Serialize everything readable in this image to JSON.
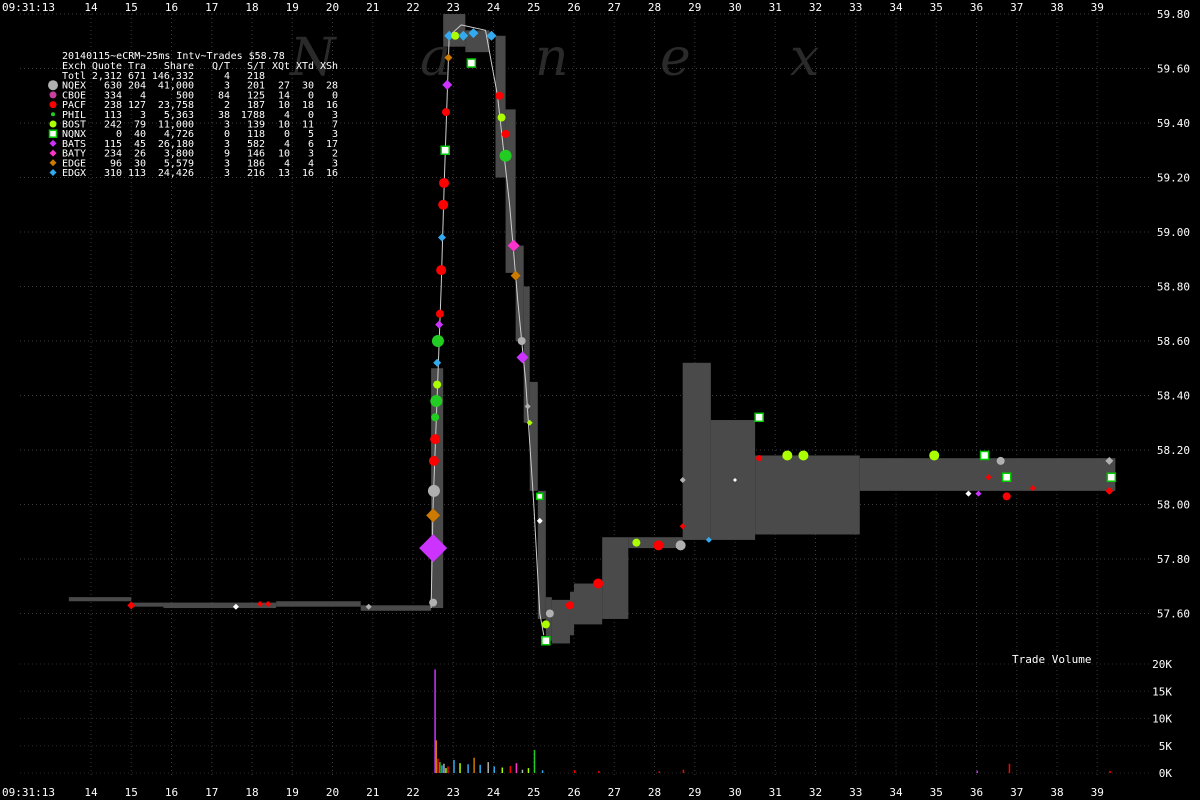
{
  "chart_data": {
    "type": "scatter",
    "title": "20140115~eCRM~25ms Intv~Trades $58.78",
    "start_time": "09:31:13",
    "watermark": [
      "N",
      "a",
      "n",
      "e",
      "x"
    ],
    "x_ticks": [
      "14",
      "15",
      "16",
      "17",
      "18",
      "19",
      "20",
      "21",
      "22",
      "23",
      "24",
      "25",
      "26",
      "27",
      "28",
      "29",
      "30",
      "31",
      "32",
      "33",
      "34",
      "35",
      "36",
      "37",
      "38",
      "39"
    ],
    "y_ticks": [
      "59.80",
      "59.60",
      "59.40",
      "59.20",
      "59.00",
      "58.80",
      "58.60",
      "58.40",
      "58.20",
      "58.00",
      "57.80",
      "57.60"
    ],
    "ylim": [
      57.42,
      59.86
    ],
    "volume_label": "Trade Volume",
    "volume_ticks": [
      "20K",
      "15K",
      "10K",
      "5K",
      "0K"
    ],
    "volume_max": 20000,
    "grid": true,
    "table": {
      "headers": [
        "Exch",
        "Quote",
        "Tra",
        "Share",
        "Q/T",
        "S/T",
        "XQt",
        "XTd",
        "XSh"
      ],
      "rows": [
        {
          "exch": "Totl",
          "quote": "2,312",
          "tra": "671",
          "share": "146,332",
          "qt": "4",
          "st": "218",
          "xqt": "",
          "xtd": "",
          "xsh": "",
          "color": "",
          "shape": ""
        },
        {
          "exch": "NQEX",
          "quote": "630",
          "tra": "204",
          "share": "41,000",
          "qt": "3",
          "st": "201",
          "xqt": "27",
          "xtd": "30",
          "xsh": "28",
          "color": "#b0b0b0",
          "shape": "circle-lg"
        },
        {
          "exch": "CBOE",
          "quote": "334",
          "tra": "4",
          "share": "500",
          "qt": "84",
          "st": "125",
          "xqt": "14",
          "xtd": "0",
          "xsh": "0",
          "color": "#c8409c",
          "shape": "circle"
        },
        {
          "exch": "PACF",
          "quote": "238",
          "tra": "127",
          "share": "23,758",
          "qt": "2",
          "st": "187",
          "xqt": "10",
          "xtd": "18",
          "xsh": "16",
          "color": "#ff0000",
          "shape": "circle"
        },
        {
          "exch": "PHIL",
          "quote": "113",
          "tra": "3",
          "share": "5,363",
          "qt": "38",
          "st": "1788",
          "xqt": "4",
          "xtd": "0",
          "xsh": "3",
          "color": "#22cc22",
          "shape": "circle-sm"
        },
        {
          "exch": "BOST",
          "quote": "242",
          "tra": "79",
          "share": "11,000",
          "qt": "3",
          "st": "139",
          "xqt": "10",
          "xtd": "11",
          "xsh": "7",
          "color": "#aaff00",
          "shape": "circle"
        },
        {
          "exch": "NQNX",
          "quote": "0",
          "tra": "40",
          "share": "4,726",
          "qt": "0",
          "st": "118",
          "xqt": "0",
          "xtd": "5",
          "xsh": "3",
          "color": "#00cc00",
          "shape": "square"
        },
        {
          "exch": "BATS",
          "quote": "115",
          "tra": "45",
          "share": "26,180",
          "qt": "3",
          "st": "582",
          "xqt": "4",
          "xtd": "6",
          "xsh": "17",
          "color": "#cc33ff",
          "shape": "diamond"
        },
        {
          "exch": "BATY",
          "quote": "234",
          "tra": "26",
          "share": "3,800",
          "qt": "9",
          "st": "146",
          "xqt": "10",
          "xtd": "3",
          "xsh": "2",
          "color": "#ff33cc",
          "shape": "diamond"
        },
        {
          "exch": "EDGE",
          "quote": "96",
          "tra": "30",
          "share": "5,579",
          "qt": "3",
          "st": "186",
          "xqt": "4",
          "xtd": "4",
          "xsh": "3",
          "color": "#cc7a00",
          "shape": "diamond"
        },
        {
          "exch": "EDGX",
          "quote": "310",
          "tra": "113",
          "share": "24,426",
          "qt": "3",
          "st": "216",
          "xqt": "13",
          "xtd": "16",
          "xsh": "16",
          "color": "#33aaee",
          "shape": "diamond"
        }
      ]
    },
    "quote_band": [
      {
        "x0": 13.45,
        "x1": 15.0,
        "lo": 57.645,
        "hi": 57.66
      },
      {
        "x0": 15.0,
        "x1": 15.8,
        "lo": 57.625,
        "hi": 57.64
      },
      {
        "x0": 15.8,
        "x1": 18.6,
        "lo": 57.62,
        "hi": 57.64
      },
      {
        "x0": 18.6,
        "x1": 20.7,
        "lo": 57.625,
        "hi": 57.645
      },
      {
        "x0": 20.7,
        "x1": 22.45,
        "lo": 57.61,
        "hi": 57.63
      },
      {
        "x0": 22.45,
        "x1": 22.75,
        "lo": 57.62,
        "hi": 58.5
      },
      {
        "x0": 22.75,
        "x1": 23.3,
        "lo": 59.68,
        "hi": 59.8
      },
      {
        "x0": 23.3,
        "x1": 23.9,
        "lo": 59.66,
        "hi": 59.74
      },
      {
        "x0": 24.05,
        "x1": 24.3,
        "lo": 59.2,
        "hi": 59.72
      },
      {
        "x0": 24.3,
        "x1": 24.55,
        "lo": 58.85,
        "hi": 59.45
      },
      {
        "x0": 24.55,
        "x1": 24.75,
        "lo": 58.6,
        "hi": 58.95
      },
      {
        "x0": 24.75,
        "x1": 24.9,
        "lo": 58.3,
        "hi": 58.8
      },
      {
        "x0": 24.9,
        "x1": 25.1,
        "lo": 58.05,
        "hi": 58.45
      },
      {
        "x0": 25.1,
        "x1": 25.3,
        "lo": 57.58,
        "hi": 58.05
      },
      {
        "x0": 25.3,
        "x1": 25.45,
        "lo": 57.5,
        "hi": 57.66
      },
      {
        "x0": 25.45,
        "x1": 25.9,
        "lo": 57.49,
        "hi": 57.65
      },
      {
        "x0": 25.9,
        "x1": 26.0,
        "lo": 57.52,
        "hi": 57.68
      },
      {
        "x0": 26.0,
        "x1": 26.7,
        "lo": 57.56,
        "hi": 57.71
      },
      {
        "x0": 26.7,
        "x1": 27.35,
        "lo": 57.58,
        "hi": 57.88
      },
      {
        "x0": 27.35,
        "x1": 28.7,
        "lo": 57.84,
        "hi": 57.88
      },
      {
        "x0": 28.7,
        "x1": 29.4,
        "lo": 57.87,
        "hi": 58.52
      },
      {
        "x0": 29.4,
        "x1": 30.5,
        "lo": 57.87,
        "hi": 58.31
      },
      {
        "x0": 30.5,
        "x1": 33.1,
        "lo": 57.89,
        "hi": 58.18
      },
      {
        "x0": 33.1,
        "x1": 39.45,
        "lo": 58.05,
        "hi": 58.17
      }
    ],
    "price_trace": [
      {
        "x": 22.45,
        "y": 57.62
      },
      {
        "x": 22.5,
        "y": 58.0
      },
      {
        "x": 22.6,
        "y": 58.4
      },
      {
        "x": 22.7,
        "y": 58.8
      },
      {
        "x": 22.78,
        "y": 59.2
      },
      {
        "x": 22.85,
        "y": 59.5
      },
      {
        "x": 22.9,
        "y": 59.72
      },
      {
        "x": 23.2,
        "y": 59.76
      },
      {
        "x": 23.8,
        "y": 59.74
      },
      {
        "x": 24.1,
        "y": 59.5
      },
      {
        "x": 24.4,
        "y": 59.1
      },
      {
        "x": 24.6,
        "y": 58.75
      },
      {
        "x": 24.8,
        "y": 58.45
      },
      {
        "x": 25.0,
        "y": 58.0
      },
      {
        "x": 25.15,
        "y": 57.6
      },
      {
        "x": 25.25,
        "y": 57.52
      }
    ],
    "trades": [
      {
        "x": 15.0,
        "y": 57.63,
        "exch": "PACF",
        "shape": "diamond",
        "size": 4
      },
      {
        "x": 17.6,
        "y": 57.625,
        "exch": "white",
        "shape": "diamond",
        "size": 3
      },
      {
        "x": 18.2,
        "y": 57.635,
        "exch": "PACF",
        "shape": "diamond",
        "size": 3
      },
      {
        "x": 18.4,
        "y": 57.635,
        "exch": "PACF",
        "shape": "diamond",
        "size": 3
      },
      {
        "x": 20.9,
        "y": 57.625,
        "exch": "NQEX",
        "shape": "diamond",
        "size": 3
      },
      {
        "x": 22.5,
        "y": 57.64,
        "exch": "NQEX",
        "shape": "circle",
        "size": 4
      },
      {
        "x": 22.5,
        "y": 57.84,
        "exch": "BATS",
        "shape": "diamond",
        "size": 14
      },
      {
        "x": 22.5,
        "y": 57.96,
        "exch": "EDGE",
        "shape": "diamond",
        "size": 7
      },
      {
        "x": 22.52,
        "y": 58.05,
        "exch": "NQEX",
        "shape": "circle",
        "size": 6
      },
      {
        "x": 22.52,
        "y": 58.16,
        "exch": "PACF",
        "shape": "circle",
        "size": 5
      },
      {
        "x": 22.55,
        "y": 58.24,
        "exch": "PACF",
        "shape": "circle",
        "size": 5
      },
      {
        "x": 22.55,
        "y": 58.32,
        "exch": "PHIL",
        "shape": "circle",
        "size": 4
      },
      {
        "x": 22.58,
        "y": 58.38,
        "exch": "PHIL",
        "shape": "circle",
        "size": 6
      },
      {
        "x": 22.6,
        "y": 58.44,
        "exch": "BOST",
        "shape": "circle",
        "size": 4
      },
      {
        "x": 22.6,
        "y": 58.52,
        "exch": "EDGX",
        "shape": "diamond",
        "size": 4
      },
      {
        "x": 22.62,
        "y": 58.6,
        "exch": "PHIL",
        "shape": "circle",
        "size": 6
      },
      {
        "x": 22.65,
        "y": 58.66,
        "exch": "BATS",
        "shape": "diamond",
        "size": 4
      },
      {
        "x": 22.67,
        "y": 58.7,
        "exch": "PACF",
        "shape": "circle",
        "size": 4
      },
      {
        "x": 22.7,
        "y": 58.86,
        "exch": "PACF",
        "shape": "circle",
        "size": 5
      },
      {
        "x": 22.72,
        "y": 58.98,
        "exch": "EDGX",
        "shape": "diamond",
        "size": 4
      },
      {
        "x": 22.75,
        "y": 59.1,
        "exch": "PACF",
        "shape": "circle",
        "size": 5
      },
      {
        "x": 22.77,
        "y": 59.18,
        "exch": "PACF",
        "shape": "circle",
        "size": 5
      },
      {
        "x": 22.8,
        "y": 59.3,
        "exch": "NQNX",
        "shape": "square",
        "size": 4
      },
      {
        "x": 22.82,
        "y": 59.44,
        "exch": "PACF",
        "shape": "circle",
        "size": 4
      },
      {
        "x": 22.85,
        "y": 59.54,
        "exch": "BATS",
        "shape": "diamond",
        "size": 5
      },
      {
        "x": 22.88,
        "y": 59.64,
        "exch": "EDGE",
        "shape": "diamond",
        "size": 4
      },
      {
        "x": 22.9,
        "y": 59.72,
        "exch": "EDGX",
        "shape": "diamond",
        "size": 5
      },
      {
        "x": 23.05,
        "y": 59.72,
        "exch": "BOST",
        "shape": "circle",
        "size": 4
      },
      {
        "x": 23.25,
        "y": 59.72,
        "exch": "EDGX",
        "shape": "diamond",
        "size": 5
      },
      {
        "x": 23.5,
        "y": 59.73,
        "exch": "EDGX",
        "shape": "diamond",
        "size": 5
      },
      {
        "x": 23.45,
        "y": 59.62,
        "exch": "NQNX",
        "shape": "square",
        "size": 4
      },
      {
        "x": 23.95,
        "y": 59.72,
        "exch": "EDGX",
        "shape": "diamond",
        "size": 5
      },
      {
        "x": 24.15,
        "y": 59.5,
        "exch": "PACF",
        "shape": "circle",
        "size": 4
      },
      {
        "x": 24.2,
        "y": 59.42,
        "exch": "BOST",
        "shape": "circle",
        "size": 4
      },
      {
        "x": 24.3,
        "y": 59.36,
        "exch": "PACF",
        "shape": "circle",
        "size": 4
      },
      {
        "x": 24.3,
        "y": 59.28,
        "exch": "PHIL",
        "shape": "circle",
        "size": 6
      },
      {
        "x": 24.5,
        "y": 58.95,
        "exch": "BATY",
        "shape": "diamond",
        "size": 6
      },
      {
        "x": 24.55,
        "y": 58.84,
        "exch": "EDGE",
        "shape": "diamond",
        "size": 5
      },
      {
        "x": 24.7,
        "y": 58.6,
        "exch": "NQEX",
        "shape": "circle",
        "size": 4
      },
      {
        "x": 24.72,
        "y": 58.54,
        "exch": "BATS",
        "shape": "diamond",
        "size": 6
      },
      {
        "x": 24.85,
        "y": 58.36,
        "exch": "NQEX",
        "shape": "diamond",
        "size": 3
      },
      {
        "x": 24.9,
        "y": 58.3,
        "exch": "BOST",
        "shape": "diamond",
        "size": 3
      },
      {
        "x": 25.15,
        "y": 58.03,
        "exch": "NQNX",
        "shape": "square",
        "size": 3
      },
      {
        "x": 25.15,
        "y": 57.94,
        "exch": "white",
        "shape": "diamond",
        "size": 3
      },
      {
        "x": 25.3,
        "y": 57.56,
        "exch": "BOST",
        "shape": "circle",
        "size": 4
      },
      {
        "x": 25.3,
        "y": 57.5,
        "exch": "NQNX",
        "shape": "square",
        "size": 4
      },
      {
        "x": 25.4,
        "y": 57.6,
        "exch": "NQEX",
        "shape": "circle",
        "size": 4
      },
      {
        "x": 25.9,
        "y": 57.63,
        "exch": "PACF",
        "shape": "circle",
        "size": 4
      },
      {
        "x": 26.6,
        "y": 57.71,
        "exch": "PACF",
        "shape": "circle",
        "size": 5
      },
      {
        "x": 27.55,
        "y": 57.86,
        "exch": "BOST",
        "shape": "circle",
        "size": 4
      },
      {
        "x": 28.1,
        "y": 57.85,
        "exch": "PACF",
        "shape": "circle",
        "size": 5
      },
      {
        "x": 28.65,
        "y": 57.85,
        "exch": "NQEX",
        "shape": "circle",
        "size": 5
      },
      {
        "x": 28.7,
        "y": 57.92,
        "exch": "PACF",
        "shape": "diamond",
        "size": 3
      },
      {
        "x": 28.7,
        "y": 58.09,
        "exch": "NQEX",
        "shape": "diamond",
        "size": 3
      },
      {
        "x": 29.35,
        "y": 57.87,
        "exch": "EDGX",
        "shape": "diamond",
        "size": 3
      },
      {
        "x": 30.0,
        "y": 58.09,
        "exch": "white",
        "shape": "diamond",
        "size": 2
      },
      {
        "x": 30.6,
        "y": 58.17,
        "exch": "PACF",
        "shape": "circle",
        "size": 3
      },
      {
        "x": 30.6,
        "y": 58.32,
        "exch": "NQNX",
        "shape": "square",
        "size": 4
      },
      {
        "x": 31.3,
        "y": 58.18,
        "exch": "BOST",
        "shape": "circle",
        "size": 5
      },
      {
        "x": 31.7,
        "y": 58.18,
        "exch": "BOST",
        "shape": "circle",
        "size": 5
      },
      {
        "x": 34.95,
        "y": 58.18,
        "exch": "BOST",
        "shape": "circle",
        "size": 5
      },
      {
        "x": 35.8,
        "y": 58.04,
        "exch": "white",
        "shape": "diamond",
        "size": 3
      },
      {
        "x": 36.05,
        "y": 58.04,
        "exch": "BATS",
        "shape": "diamond",
        "size": 3
      },
      {
        "x": 36.2,
        "y": 58.18,
        "exch": "NQNX",
        "shape": "square",
        "size": 4
      },
      {
        "x": 36.3,
        "y": 58.1,
        "exch": "PACF",
        "shape": "diamond",
        "size": 3
      },
      {
        "x": 36.6,
        "y": 58.16,
        "exch": "NQEX",
        "shape": "circle",
        "size": 4
      },
      {
        "x": 36.75,
        "y": 58.1,
        "exch": "NQNX",
        "shape": "square",
        "size": 4
      },
      {
        "x": 36.75,
        "y": 58.03,
        "exch": "PACF",
        "shape": "circle",
        "size": 4
      },
      {
        "x": 37.4,
        "y": 58.06,
        "exch": "PACF",
        "shape": "diamond",
        "size": 3
      },
      {
        "x": 39.3,
        "y": 58.16,
        "exch": "NQEX",
        "shape": "diamond",
        "size": 4
      },
      {
        "x": 39.3,
        "y": 58.05,
        "exch": "PACF",
        "shape": "diamond",
        "size": 4
      },
      {
        "x": 39.35,
        "y": 58.1,
        "exch": "NQNX",
        "shape": "square",
        "size": 4
      }
    ],
    "volume_bars": [
      {
        "x": 22.53,
        "v": 19000,
        "exch": "BATS"
      },
      {
        "x": 22.56,
        "v": 6000,
        "exch": "EDGE"
      },
      {
        "x": 22.6,
        "v": 2600,
        "exch": "PACF"
      },
      {
        "x": 22.65,
        "v": 2000,
        "exch": "PHIL"
      },
      {
        "x": 22.7,
        "v": 1400,
        "exch": "EDGX"
      },
      {
        "x": 22.75,
        "v": 1700,
        "exch": "NQEX"
      },
      {
        "x": 22.8,
        "v": 900,
        "exch": "BOST"
      },
      {
        "x": 22.85,
        "v": 1200,
        "exch": "PACF"
      },
      {
        "x": 23.0,
        "v": 2400,
        "exch": "EDGX"
      },
      {
        "x": 23.15,
        "v": 1800,
        "exch": "BOST"
      },
      {
        "x": 23.35,
        "v": 1600,
        "exch": "EDGX"
      },
      {
        "x": 23.5,
        "v": 2800,
        "exch": "EDGE"
      },
      {
        "x": 23.65,
        "v": 1500,
        "exch": "EDGX"
      },
      {
        "x": 23.85,
        "v": 2000,
        "exch": "NQEX"
      },
      {
        "x": 24.0,
        "v": 1200,
        "exch": "EDGX"
      },
      {
        "x": 24.2,
        "v": 1000,
        "exch": "BOST"
      },
      {
        "x": 24.4,
        "v": 1300,
        "exch": "PACF"
      },
      {
        "x": 24.55,
        "v": 1800,
        "exch": "BATY"
      },
      {
        "x": 24.7,
        "v": 600,
        "exch": "NQEX"
      },
      {
        "x": 24.85,
        "v": 900,
        "exch": "BOST"
      },
      {
        "x": 25.0,
        "v": 4200,
        "exch": "PHIL"
      },
      {
        "x": 25.2,
        "v": 500,
        "exch": "EDGX"
      },
      {
        "x": 26.0,
        "v": 500,
        "exch": "PACF"
      },
      {
        "x": 26.6,
        "v": 400,
        "exch": "PACF"
      },
      {
        "x": 28.1,
        "v": 300,
        "exch": "PACF"
      },
      {
        "x": 28.7,
        "v": 600,
        "exch": "PACF"
      },
      {
        "x": 36.0,
        "v": 400,
        "exch": "BATS"
      },
      {
        "x": 36.8,
        "v": 1700,
        "exch": "PACF"
      },
      {
        "x": 39.3,
        "v": 400,
        "exch": "PACF"
      }
    ]
  }
}
